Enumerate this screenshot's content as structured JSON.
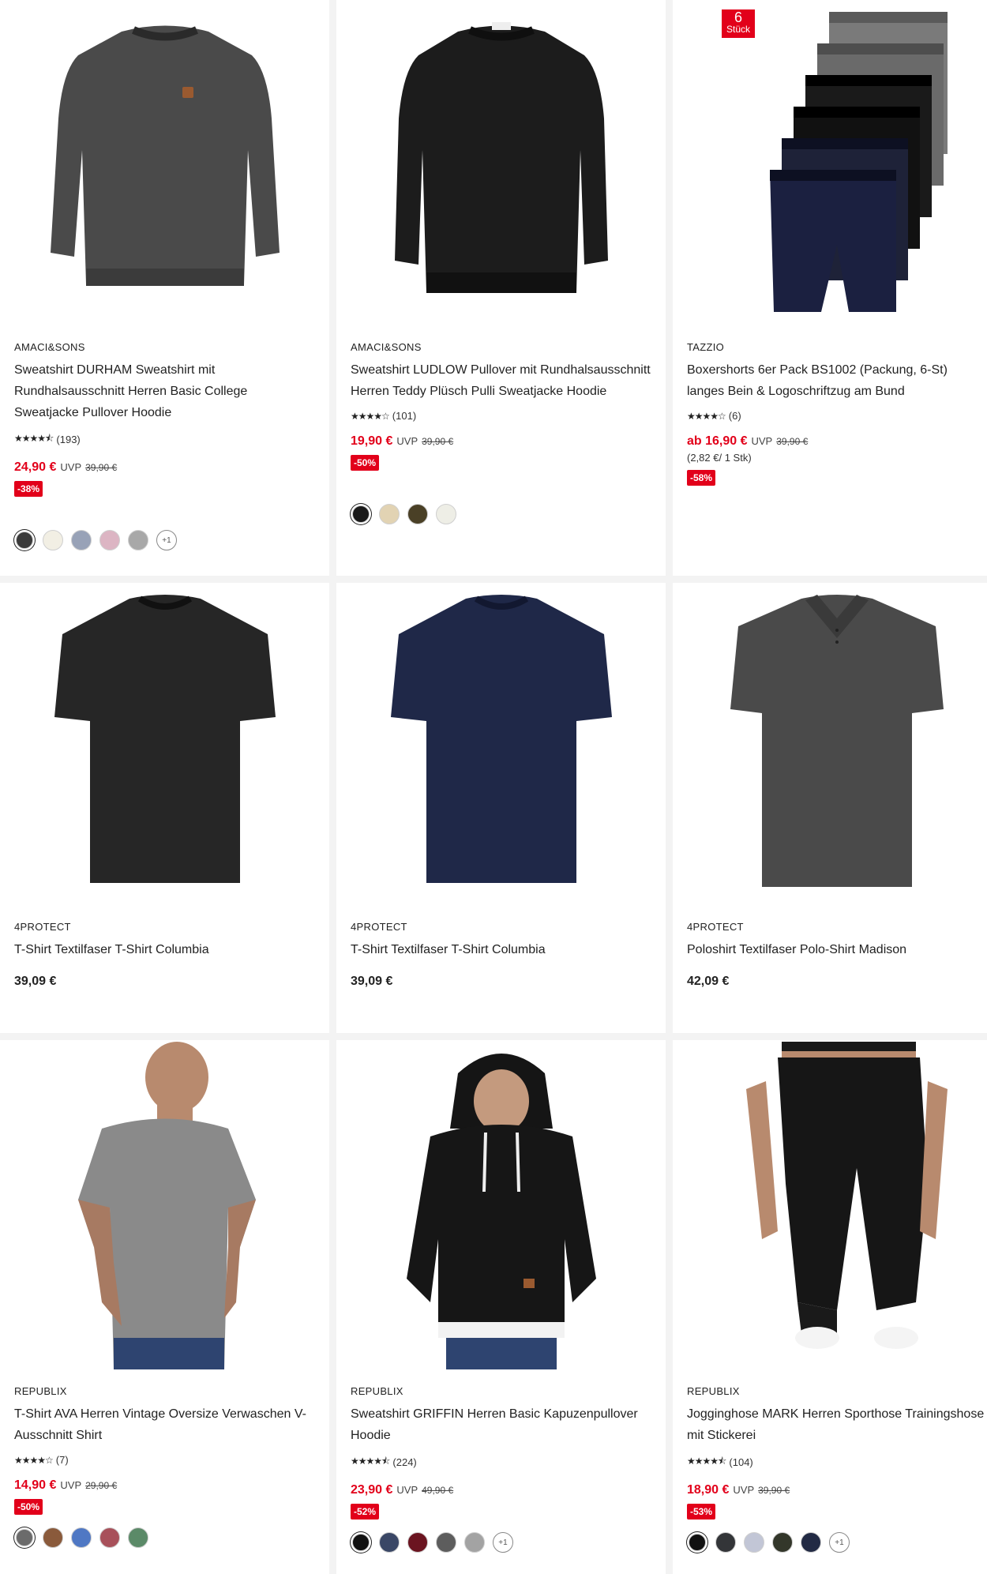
{
  "products": [
    {
      "brand": "AMACI&SONS",
      "title": "Sweatshirt DURHAM Sweatshirt mit Rundhalsausschnitt Herren Basic College Sweatjacke Pullover Hoodie",
      "rating_stars": 4.5,
      "rating_count": "(193)",
      "price": "24,90 €",
      "uvp_label": "UVP",
      "old_price": "39,90 €",
      "discount": "-38%",
      "swatch_colors": [
        "#3a3a3a",
        "#f2efe4",
        "#98a2b7",
        "#dcb5c3",
        "#a8a8a8"
      ],
      "more_colors": "+1",
      "image": "sweatshirt-grey"
    },
    {
      "brand": "AMACI&SONS",
      "title": "Sweatshirt LUDLOW Pullover mit Rundhalsausschnitt Herren Teddy Plüsch Pulli Sweatjacke Hoodie",
      "rating_stars": 4,
      "rating_count": "(101)",
      "price": "19,90 €",
      "uvp_label": "UVP",
      "old_price": "39,90 €",
      "discount": "-50%",
      "swatch_colors": [
        "#1a1a1a",
        "#e2d3b3",
        "#4a4026",
        "#eeeee6"
      ],
      "image": "sweatshirt-black-teddy"
    },
    {
      "brand": "TAZZIO",
      "title": "Boxershorts 6er Pack BS1002 (Packung, 6-St) langes Bein & Logoschriftzug am Bund",
      "rating_stars": 4,
      "rating_count": "(6)",
      "price": "ab 16,90 €",
      "uvp_label": "UVP",
      "old_price": "39,90 €",
      "unit_price": "(2,82 €/ 1 Stk)",
      "discount": "-58%",
      "pack_number": "6",
      "pack_label": "Stück",
      "image": "boxershorts-pack"
    },
    {
      "brand": "4PROTECT",
      "title": "T-Shirt Textilfaser T-Shirt Columbia",
      "price": "39,09 €",
      "image": "tshirt-black"
    },
    {
      "brand": "4PROTECT",
      "title": "T-Shirt Textilfaser T-Shirt Columbia",
      "price": "39,09 €",
      "image": "tshirt-navy"
    },
    {
      "brand": "4PROTECT",
      "title": "Poloshirt Textilfaser Polo-Shirt Madison",
      "price": "42,09 €",
      "image": "polo-grey"
    },
    {
      "brand": "REPUBLIX",
      "title": "T-Shirt AVA Herren Vintage Oversize Verwaschen V-Ausschnitt Shirt",
      "rating_stars": 4,
      "rating_count": "(7)",
      "price": "14,90 €",
      "uvp_label": "UVP",
      "old_price": "29,90 €",
      "discount": "-50%",
      "swatch_colors": [
        "#6b6b6b",
        "#8a5a3b",
        "#4f78c4",
        "#a8505a",
        "#5b8a68"
      ],
      "image": "model-tshirt-grey"
    },
    {
      "brand": "REPUBLIX",
      "title": "Sweatshirt GRIFFIN Herren Basic Kapuzenpullover Hoodie",
      "rating_stars": 4.5,
      "rating_count": "(224)",
      "price": "23,90 €",
      "uvp_label": "UVP",
      "old_price": "49,90 €",
      "discount": "-52%",
      "swatch_colors": [
        "#111111",
        "#3a4766",
        "#6b1420",
        "#5d5d5d",
        "#a3a3a3"
      ],
      "more_colors": "+1",
      "image": "model-hoodie-black"
    },
    {
      "brand": "REPUBLIX",
      "title": "Jogginghose MARK Herren Sporthose Trainingshose mit Stickerei",
      "rating_stars": 4.5,
      "rating_count": "(104)",
      "price": "18,90 €",
      "uvp_label": "UVP",
      "old_price": "39,90 €",
      "discount": "-53%",
      "swatch_colors": [
        "#111111",
        "#333538",
        "#c2c6d6",
        "#33372a",
        "#222a44"
      ],
      "more_colors": "+1",
      "image": "model-joggers-black"
    }
  ]
}
